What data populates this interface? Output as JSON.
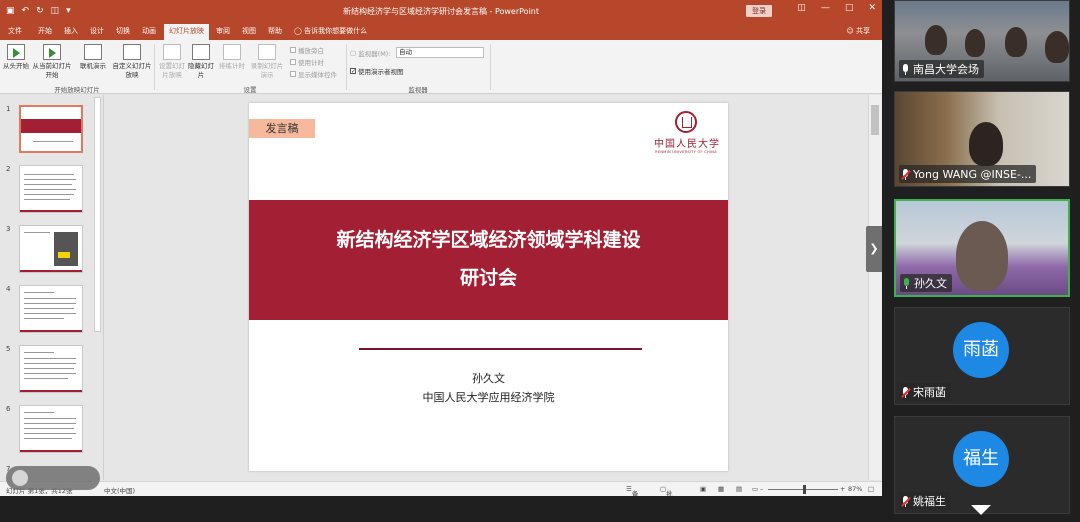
{
  "powerpoint": {
    "window_title": "新结构经济学与区域经济学研讨会发言稿 - PowerPoint",
    "login_label": "登录",
    "tabs": [
      {
        "label": "文件"
      },
      {
        "label": "开始"
      },
      {
        "label": "插入"
      },
      {
        "label": "设计"
      },
      {
        "label": "切换"
      },
      {
        "label": "动画"
      },
      {
        "label": "幻灯片放映"
      },
      {
        "label": "审阅"
      },
      {
        "label": "视图"
      },
      {
        "label": "帮助"
      }
    ],
    "tell_me": "告诉我你想要做什么",
    "share": "共享",
    "ribbon": {
      "from_beginning": "从头开始",
      "from_current": "从当前幻灯片开始",
      "online_present": "联机演示",
      "custom_show": "自定义幻灯片放映",
      "group_start": "开始放映幻灯片",
      "setup_show": "设置幻灯片放映",
      "hide_slide": "隐藏幻灯片",
      "rehearse": "排练计时",
      "record": "录制幻灯片演示",
      "play_narrations": "播放旁白",
      "use_timings": "使用计时",
      "show_media_controls": "显示媒体控件",
      "group_setup": "设置",
      "monitor_label": "监视器(M):",
      "monitor_value": "自动",
      "presenter_view": "使用演示者视图",
      "group_monitors": "监视器"
    },
    "thumbnails": [
      {
        "num": "1"
      },
      {
        "num": "2"
      },
      {
        "num": "3"
      },
      {
        "num": "4"
      },
      {
        "num": "5"
      },
      {
        "num": "6"
      },
      {
        "num": "7"
      }
    ],
    "slide": {
      "badge": "发言稿",
      "logo_cn": "中国人民大学",
      "logo_en": "RENMIN UNIVERSITY OF CHINA",
      "title_line1": "新结构经济学区域经济领域学科建设",
      "title_line2": "研讨会",
      "speaker": "孙久文",
      "affiliation": "中国人民大学应用经济学院"
    },
    "status": {
      "slide_of": "幻灯片 第1张，共12张",
      "language": "中文(中国)",
      "notes": "备注",
      "comments": "批注",
      "zoom": "87%"
    }
  },
  "meeting": {
    "participants": [
      {
        "name": "南昌大学会场",
        "mic": "on"
      },
      {
        "name": "Yong WANG @INSE-...",
        "mic": "muted"
      },
      {
        "name": "孙久文",
        "mic": "speaking"
      },
      {
        "name": "宋雨菡",
        "mic": "muted",
        "avatar": "雨菡"
      },
      {
        "name": "姚福生",
        "mic": "muted",
        "avatar": "福生"
      }
    ]
  }
}
